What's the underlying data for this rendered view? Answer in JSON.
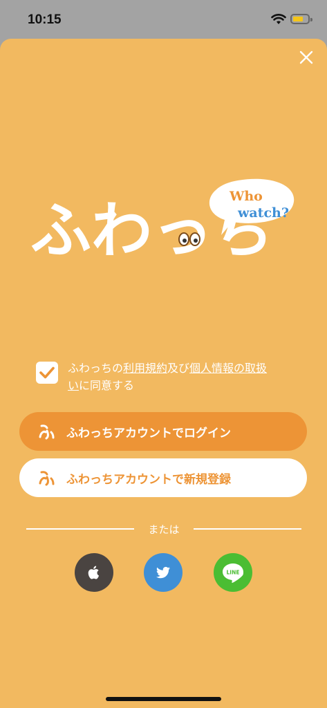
{
  "status_bar": {
    "time": "10:15"
  },
  "logo": {
    "wordmark": "ふわっち",
    "bubble_line1": "Who",
    "bubble_line2": "watch?"
  },
  "agreement": {
    "checked": true,
    "prefix": "ふわっちの",
    "terms_link": "利用規約",
    "middle": "及び",
    "privacy_link_a": "個人情報の取扱",
    "privacy_link_b": "い",
    "suffix": "に同意する"
  },
  "buttons": {
    "login_label": "ふわっちアカウントでログイン",
    "register_label": "ふわっちアカウントで新規登録"
  },
  "divider": {
    "label": "または"
  },
  "social": {
    "apple": "apple-icon",
    "twitter": "twitter-icon",
    "line_text": "LINE"
  },
  "colors": {
    "background": "#f2b960",
    "login_button": "#ed9436",
    "register_button": "#ffffff",
    "apple": "#4a4441",
    "twitter": "#3f8fd6",
    "line": "#4bbd33"
  }
}
